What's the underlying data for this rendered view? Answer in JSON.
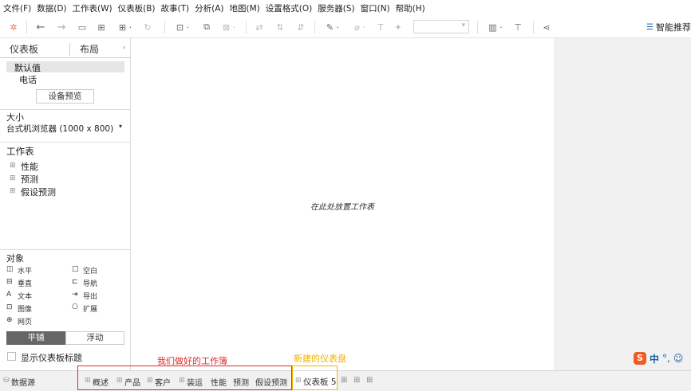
{
  "menu": [
    "文件(F)",
    "数据(D)",
    "工作表(W)",
    "仪表板(B)",
    "故事(T)",
    "分析(A)",
    "地图(M)",
    "设置格式(O)",
    "服务器(S)",
    "窗口(N)",
    "帮助(H)"
  ],
  "toolbar": {
    "recommend_label": "智能推荐"
  },
  "left_panel": {
    "tabs": [
      "仪表板",
      "布局"
    ],
    "device_default": "默认值",
    "device_phone": "电话",
    "device_preview_button": "设备预览",
    "size_header": "大小",
    "size_value": "台式机浏览器 (1000 x 800)",
    "worksheets_header": "工作表",
    "worksheets": [
      "性能",
      "预测",
      "假设预测"
    ],
    "objects_header": "对象",
    "objects_left": [
      "水平",
      "垂直",
      "文本",
      "图像",
      "网页"
    ],
    "objects_right": [
      "空白",
      "导航",
      "导出",
      "扩展"
    ],
    "tile_button": "平铺",
    "float_button": "浮动",
    "show_title_label": "显示仪表板标题"
  },
  "canvas": {
    "drop_text": "在此处放置工作表"
  },
  "bottom_tabs": {
    "datasource": "数据源",
    "existing": [
      "概述",
      "产品",
      "客户",
      "装运",
      "性能",
      "预测",
      "假设预测"
    ],
    "new_dashboard": "仪表板 5"
  },
  "annotations": {
    "red": "我们做好的工作簿",
    "yellow": "新建的仪表盘"
  },
  "ime": {
    "lang": "中",
    "punct": "°,"
  },
  "colors": {
    "annotation_red": "#e0292b",
    "annotation_yellow": "#f2b100",
    "tile_active": "#666666",
    "ime_brand": "#f05a24"
  }
}
